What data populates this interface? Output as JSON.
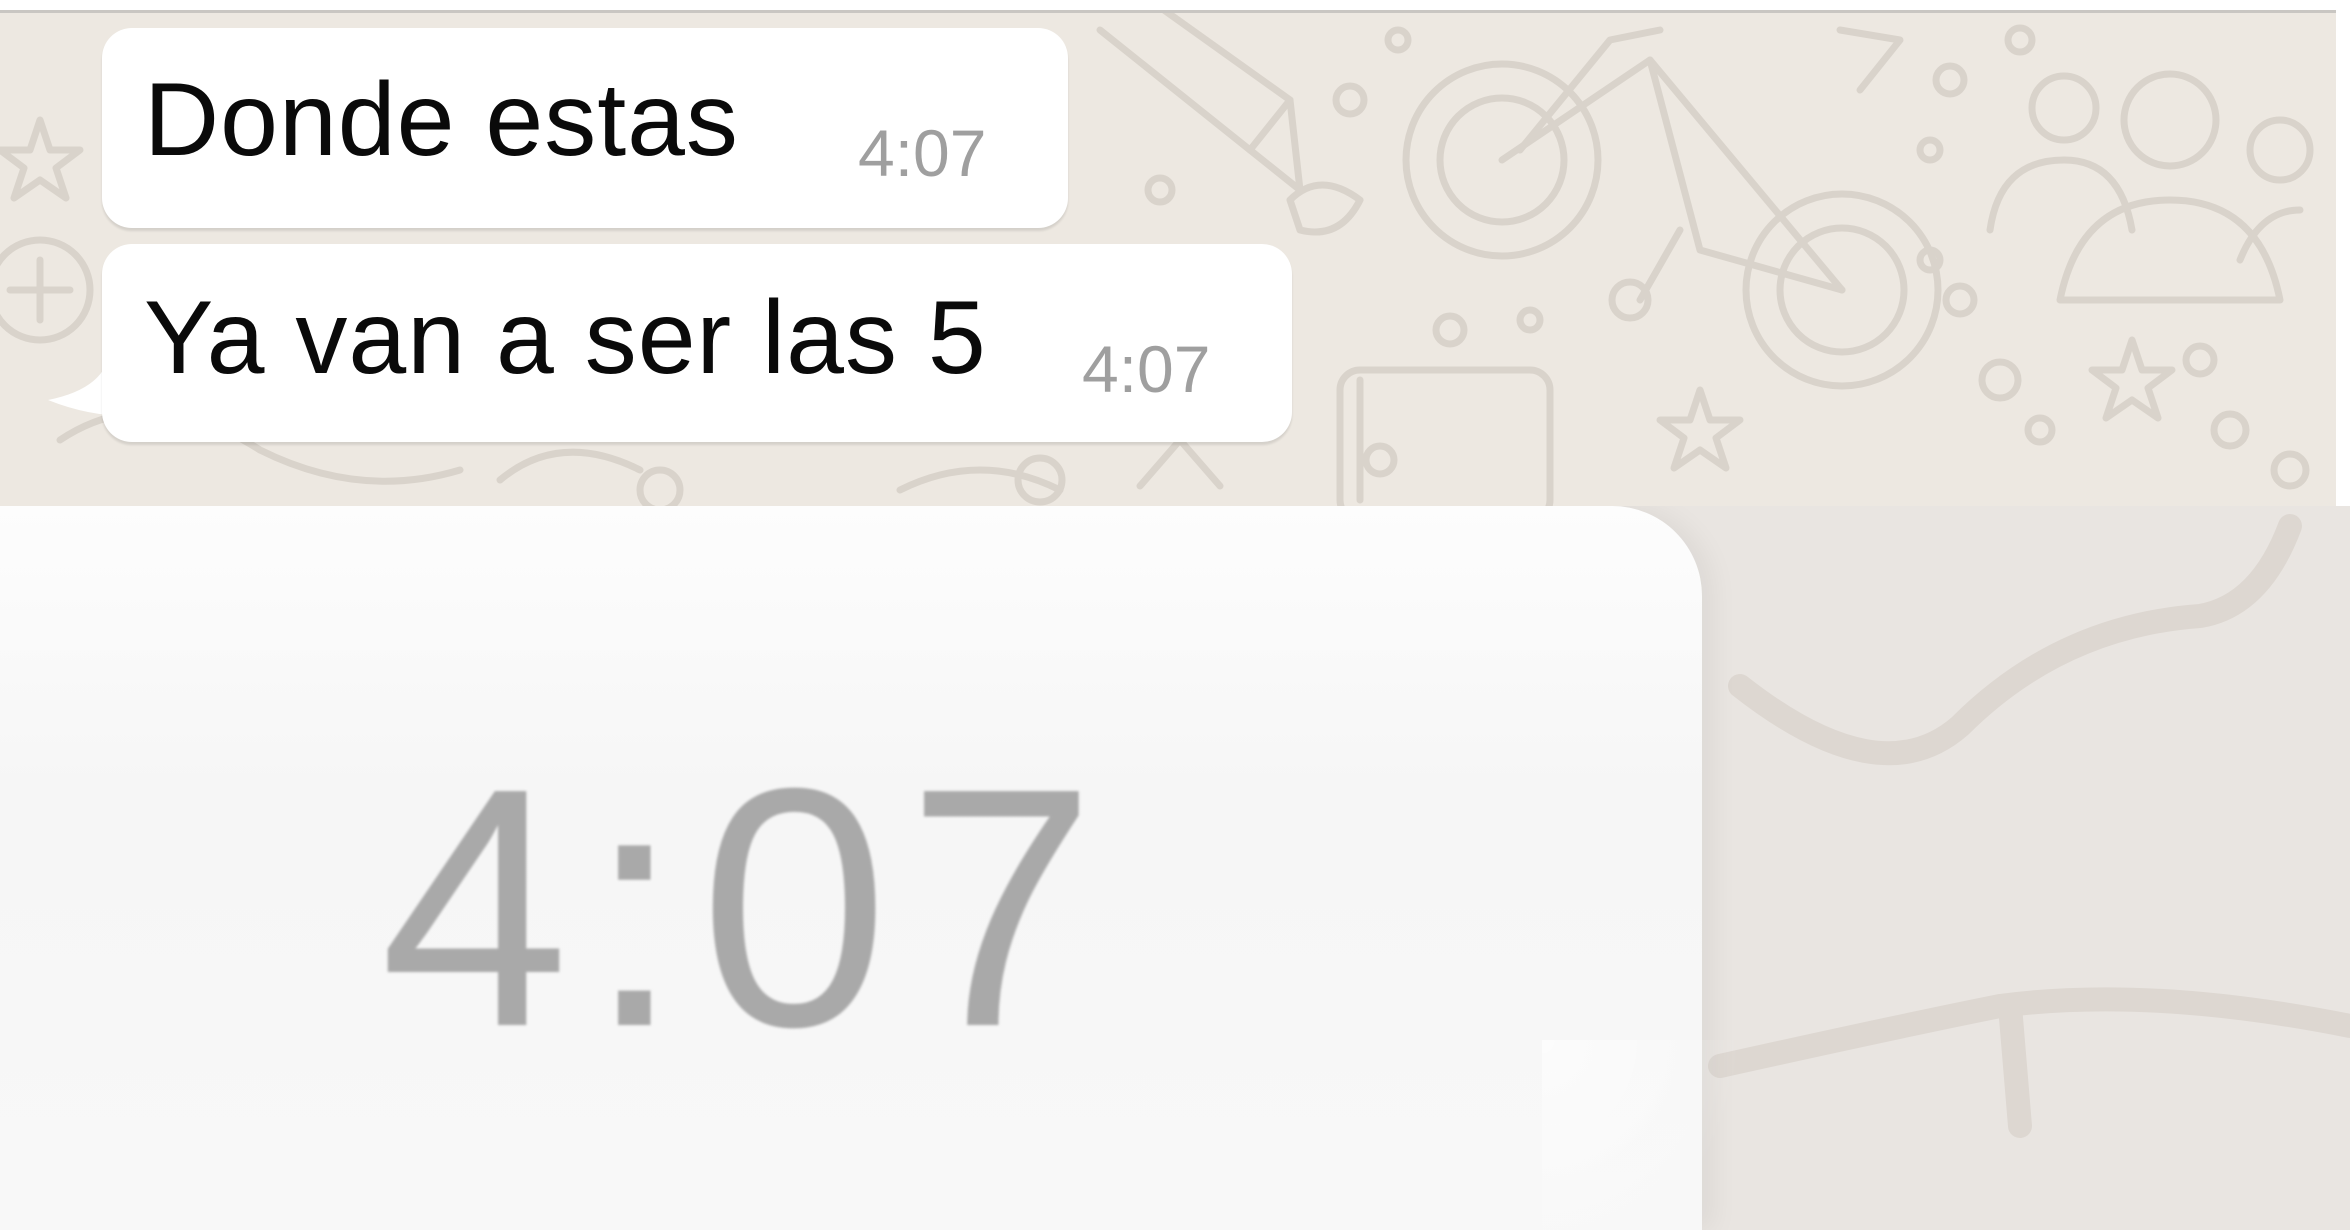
{
  "chat": {
    "messages": [
      {
        "text": "Donde estas",
        "time": "4:07"
      },
      {
        "text": "Ya van a ser las 5",
        "time": "4:07"
      }
    ],
    "background_pattern": "doodle-wallpaper",
    "colors": {
      "wallpaper": "#ede8e1",
      "bubble": "#ffffff",
      "text": "#0a0a0a",
      "timestamp": "#9f9f9f"
    }
  },
  "zoom": {
    "time": "4:07",
    "colors": {
      "bubble": "#f8f8f8",
      "text": "#a9a9a9"
    }
  }
}
